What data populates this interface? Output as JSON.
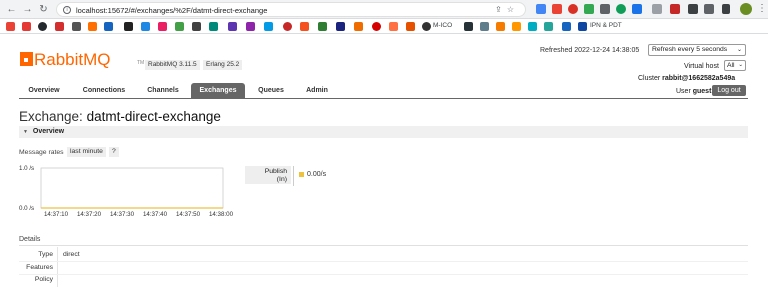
{
  "browser": {
    "url": "localhost:15672/#/exchanges/%2F/datmt-direct-exchange",
    "bookmark_mico": "M-ICO",
    "bookmark_ipn": "IPN & PDT"
  },
  "header": {
    "logo_text": "RabbitMQ",
    "logo_tm": "TM",
    "rabbitmq_version": "RabbitMQ 3.11.5",
    "erlang_version": "Erlang 25.2",
    "refreshed": "Refreshed 2022-12-24 14:38:05",
    "refresh_option": "Refresh every 5 seconds",
    "vhost_label": "Virtual host",
    "vhost_value": "All",
    "cluster_label": "Cluster",
    "cluster_name": "rabbit@1662582a549a",
    "user_label": "User",
    "user_name": "guest",
    "logout_label": "Log out"
  },
  "tabs": [
    {
      "label": "Overview"
    },
    {
      "label": "Connections"
    },
    {
      "label": "Channels"
    },
    {
      "label": "Exchanges"
    },
    {
      "label": "Queues"
    },
    {
      "label": "Admin"
    }
  ],
  "page": {
    "title_prefix": "Exchange:",
    "title_name": "datmt-direct-exchange",
    "section_overview": "Overview",
    "rates_label": "Message rates",
    "rates_range": "last minute",
    "rates_help": "?"
  },
  "chart_data": {
    "type": "line",
    "y_ticks": [
      "1.0 /s",
      "0.0 /s"
    ],
    "x_ticks": [
      "14:37:10",
      "14:37:20",
      "14:37:30",
      "14:37:40",
      "14:37:50",
      "14:38:00"
    ],
    "series": [
      {
        "name": "Publish (In)",
        "values": [
          0,
          0,
          0,
          0,
          0,
          0
        ],
        "color": "#edc240"
      }
    ],
    "ylim": [
      0,
      1
    ]
  },
  "legend": {
    "publish_label_line1": "Publish",
    "publish_label_line2": "(In)",
    "publish_value": "0.00/s"
  },
  "details": {
    "title": "Details",
    "rows": [
      {
        "key": "Type",
        "value": "direct"
      },
      {
        "key": "Features",
        "value": ""
      },
      {
        "key": "Policy",
        "value": ""
      }
    ]
  }
}
